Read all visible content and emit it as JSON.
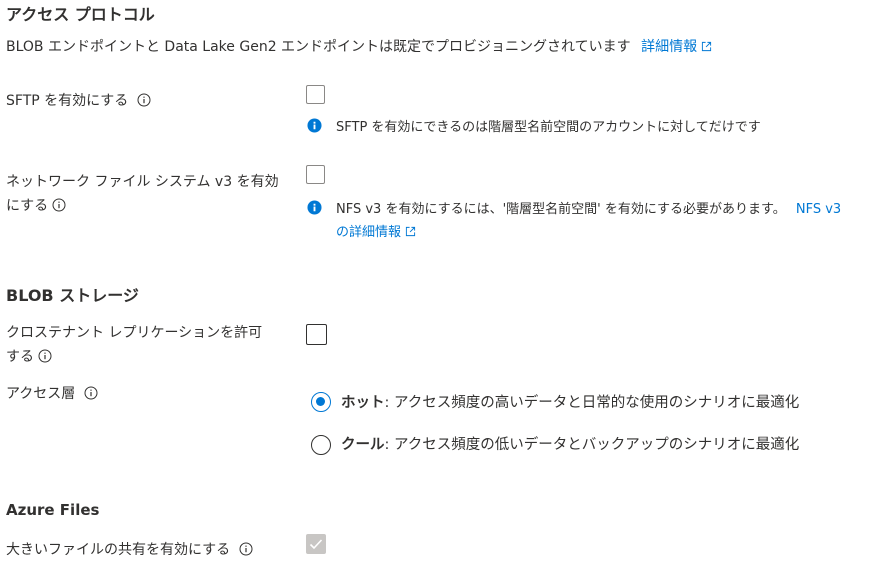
{
  "access_protocol": {
    "heading": "アクセス プロトコル",
    "description": "BLOB エンドポイントと Data Lake Gen2 エンドポイントは既定でプロビジョニングされています",
    "details_link": "詳細情報"
  },
  "sftp": {
    "label": "SFTP を有効にする",
    "checked": false,
    "info_text": "SFTP を有効にできるのは階層型名前空間のアカウントに対してだけです"
  },
  "nfs": {
    "label_line1": "ネットワーク ファイル システム v3 を有効",
    "label_line2": "にする",
    "checked": false,
    "info_text": "NFS v3 を有効にするには、'階層型名前空間' を有効にする必要があります。",
    "link_line1": "NFS v3",
    "link_line2": "の詳細情報"
  },
  "blob_storage": {
    "heading": "BLOB ストレージ"
  },
  "cross_tenant": {
    "label_line1": "クロステナント レプリケーションを許可",
    "label_line2": "する",
    "checked": false
  },
  "access_tier": {
    "label": "アクセス層",
    "options": [
      {
        "name": "ホット",
        "desc": ": アクセス頻度の高いデータと日常的な使用のシナリオに最適化",
        "selected": true
      },
      {
        "name": "クール",
        "desc": ": アクセス頻度の低いデータとバックアップのシナリオに最適化",
        "selected": false
      }
    ]
  },
  "azure_files": {
    "heading": "Azure Files",
    "large_share_label": "大きいファイルの共有を有効にする",
    "large_share_checked": true,
    "large_share_disabled": true
  },
  "colors": {
    "accent": "#0078d4",
    "text": "#323130",
    "disabled": "#c8c6c4"
  }
}
